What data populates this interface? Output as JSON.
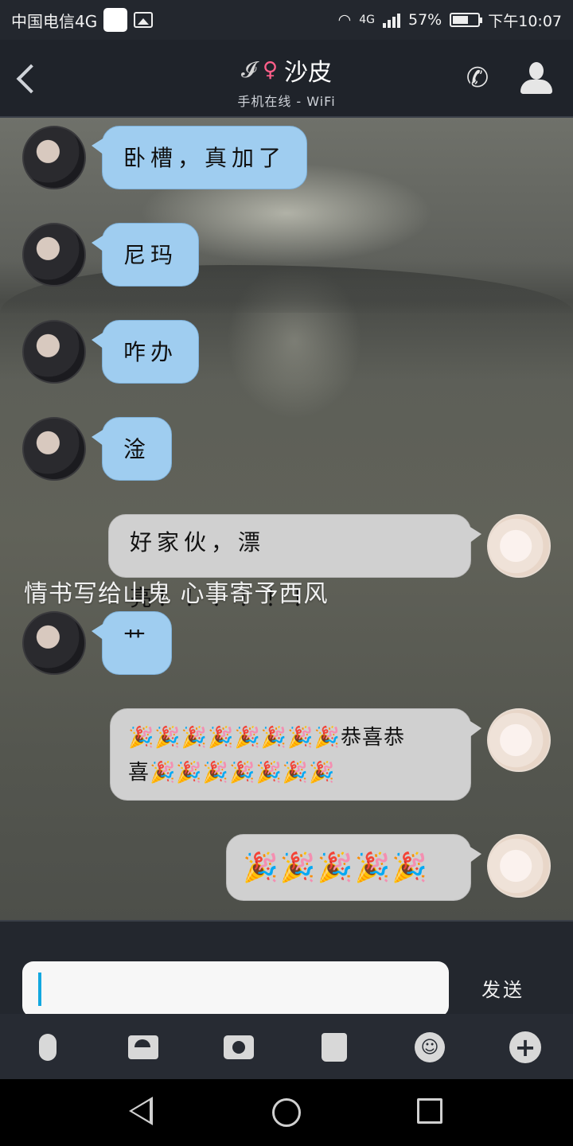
{
  "status_bar": {
    "carrier": "中国电信4G",
    "network": "4G",
    "battery": "57%",
    "time": "下午10:07"
  },
  "header": {
    "contact_name": "沙皮",
    "status": "手机在线 - WiFi",
    "ear_icon": "𝓘",
    "key_icon": "♀",
    "call_icon": "✆"
  },
  "messages": [
    {
      "side": "left",
      "text": "卧槽，真加了"
    },
    {
      "side": "left",
      "text": "尼玛"
    },
    {
      "side": "left",
      "text": "咋办"
    },
    {
      "side": "left",
      "text": "淦"
    },
    {
      "side": "right",
      "text": "好家伙，漂亮！！！！！！"
    },
    {
      "side": "left",
      "text": "艹"
    },
    {
      "side": "right",
      "line1": "🎉🎉🎉🎉🎉🎉🎉🎉恭喜恭",
      "line2": "喜🎉🎉🎉🎉🎉🎉🎉"
    },
    {
      "side": "right",
      "text": "🎉🎉🎉🎉🎉"
    }
  ],
  "overlay_text": "情书写给山鬼 心事寄予西风",
  "input": {
    "value": "",
    "send_label": "发送"
  },
  "toolbar": {
    "items": [
      "mic-icon",
      "picture-icon",
      "camera-icon",
      "wallet-icon",
      "emoji-icon",
      "plus-icon"
    ],
    "emoji_glyph": "☺",
    "plus_glyph": "+"
  },
  "nav": {
    "items": [
      "back-icon",
      "home-icon",
      "recents-icon"
    ]
  },
  "colors": {
    "left_bubble": "#9fcdf0",
    "right_bubble": "#d0d0d0",
    "accent_caret": "#13a8e0"
  }
}
